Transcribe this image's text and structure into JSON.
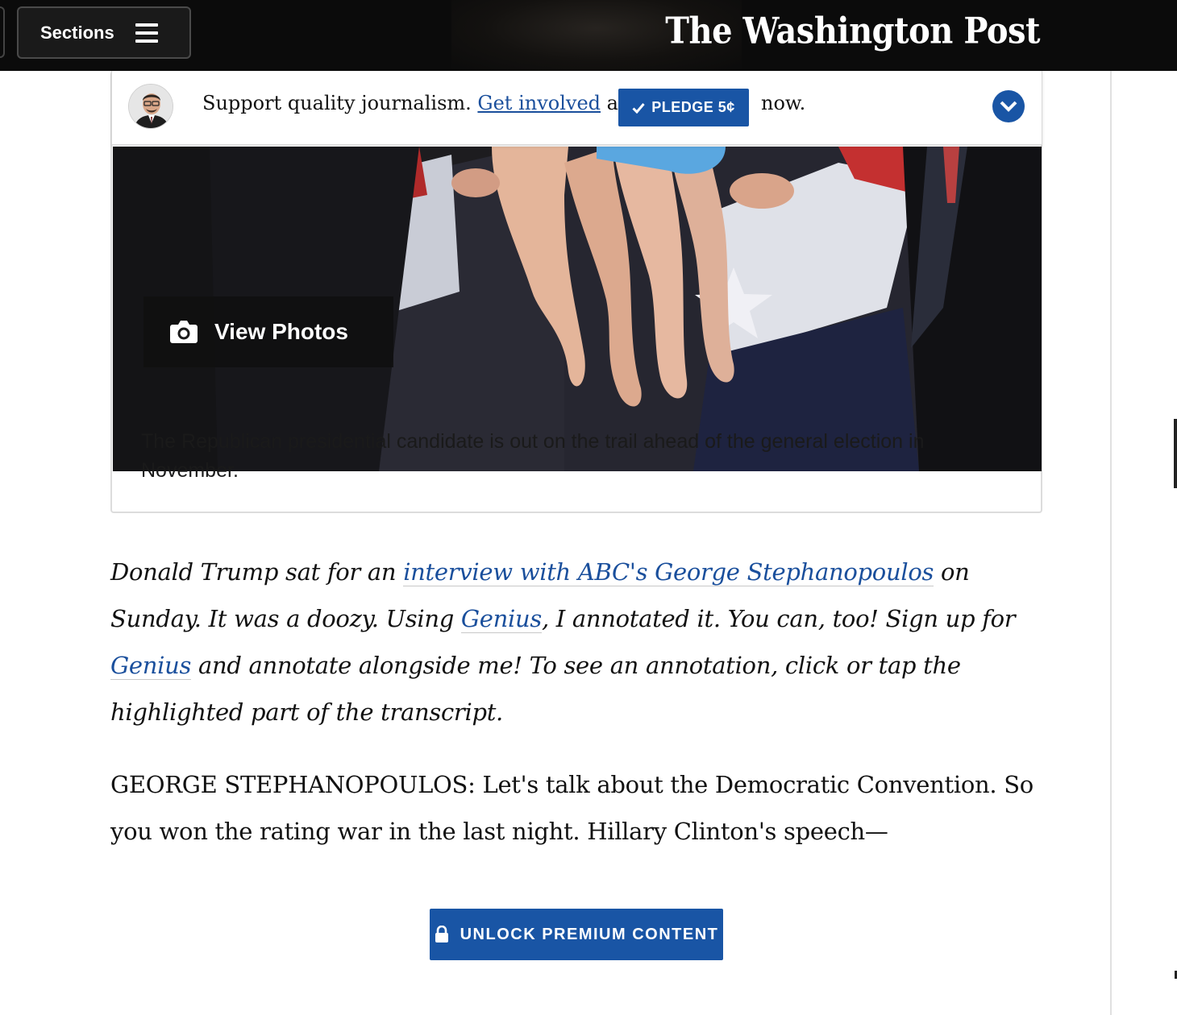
{
  "header": {
    "sections_label": "Sections",
    "logo_text": "The Washington Post"
  },
  "pledge_bar": {
    "text_before": "Support quality journalism.",
    "link_label": "Get involved",
    "text_and": "and",
    "button_label": "PLEDGE 5¢",
    "text_after": "now."
  },
  "photo": {
    "view_photos_label": "View Photos",
    "caption": "The Republican presidential candidate is out on the trail ahead of the general election in November."
  },
  "article": {
    "intro_1": "Donald Trump sat for an ",
    "intro_link_1": "interview with ABC's George Stephanopoulos",
    "intro_2": " on Sunday. It was a doozy. Using ",
    "intro_link_2": "Genius",
    "intro_3": ", I annotated it. You can, too! Sign up for ",
    "intro_link_3": "Genius",
    "intro_4": " and annotate alongside me! To see an annotation, click or tap the highlighted part of the transcript.",
    "transcript": "GEORGE STEPHANOPOULOS: Let's talk about the Democratic Convention. So you won the rating war in the last night. Hillary Clinton's speech—"
  },
  "unlock_label": "UNLOCK PREMIUM CONTENT",
  "colors": {
    "accent": "#1955a5",
    "link": "#1a4f9c",
    "topbar": "#0b0b0b"
  }
}
